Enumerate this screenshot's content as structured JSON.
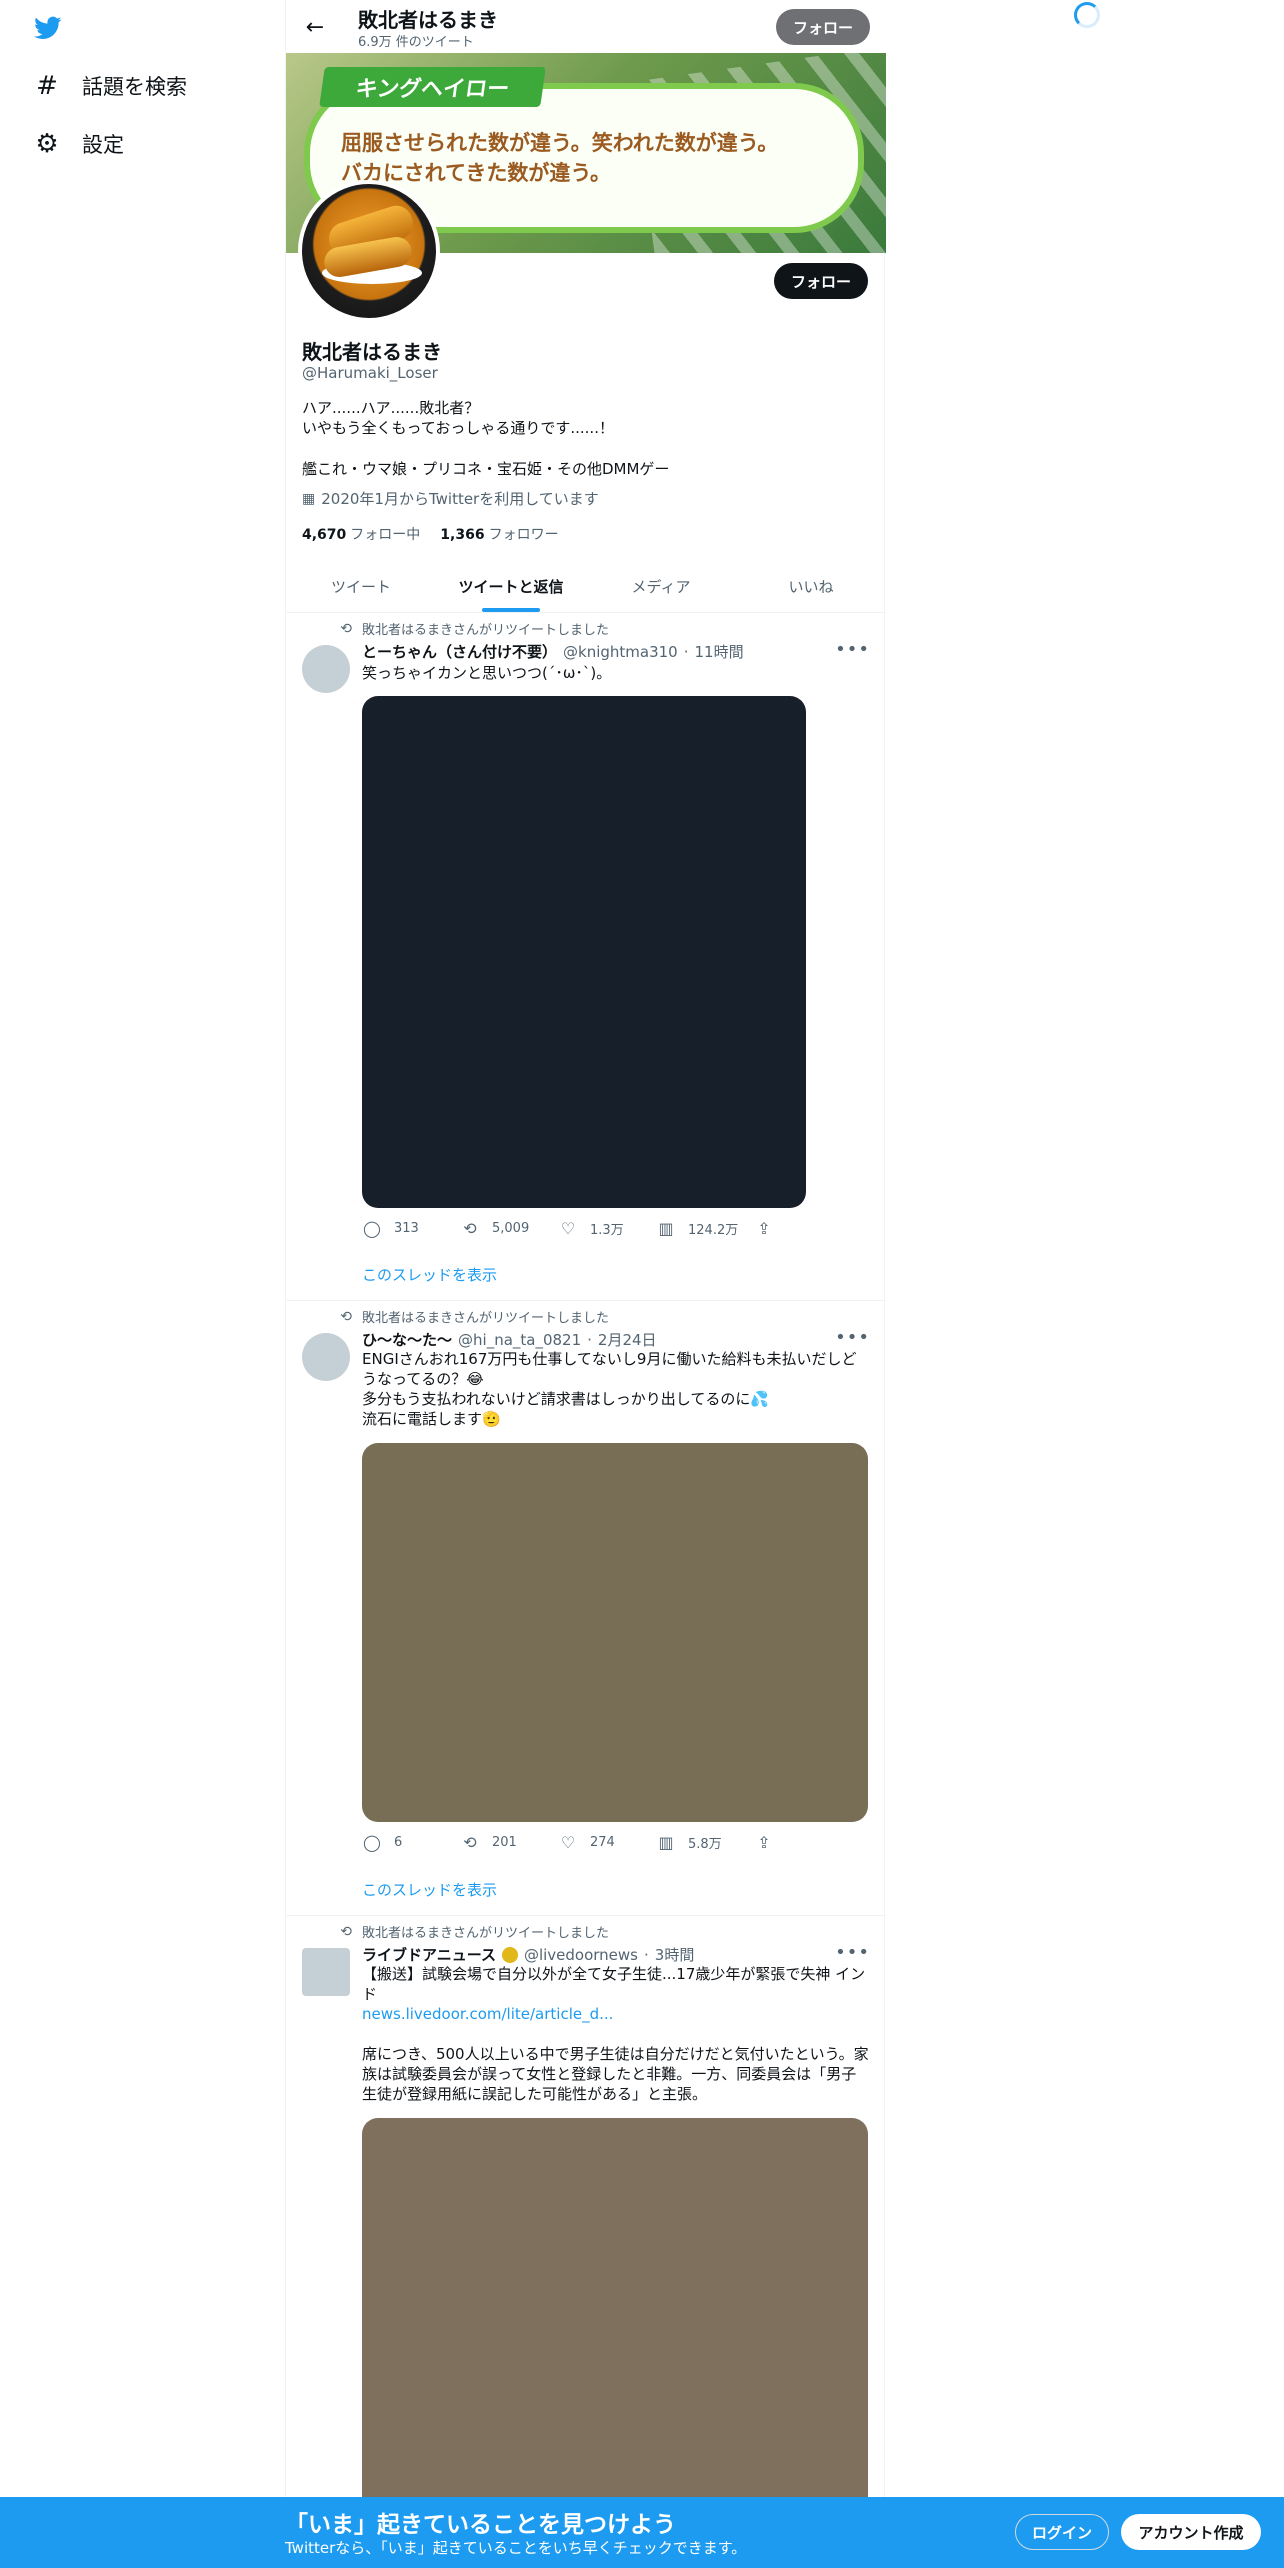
{
  "nav": {
    "explore_label": "話題を検索",
    "settings_label": "設定"
  },
  "header": {
    "name": "敗北者はるまき",
    "tweet_count": "6.9万 件のツイート",
    "follow_label": "フォロー"
  },
  "banner": {
    "tag": "キングヘイロー",
    "line1": "屈服させられた数が違う。笑われた数が違う。",
    "line2": "バカにされてきた数が違う。"
  },
  "profile": {
    "follow_label": "フォロー",
    "name": "敗北者はるまき",
    "handle": "@Harumaki_Loser",
    "bio_line1": "ハア......ハア......敗北者？",
    "bio_line2": "いやもう全くもっておっしゃる通りです......！",
    "bio_line3": "艦これ・ウマ娘・プリコネ・宝石姫・その他DMMゲー",
    "joined": "2020年1月からTwitterを利用しています",
    "following_count": "4,670",
    "following_label": "フォロー中",
    "followers_count": "1,366",
    "followers_label": "フォロワー"
  },
  "tabs": [
    {
      "label": "ツイート"
    },
    {
      "label": "ツイートと返信"
    },
    {
      "label": "メディア"
    },
    {
      "label": "いいね"
    }
  ],
  "tweets": [
    {
      "retweeted_by": "敗北者はるまきさんがリツイートしました",
      "name": "とーちゃん（さん付け不要）",
      "handle": "@knightma310",
      "time": "11時間",
      "text": "笑っちゃイカンと思いつつ(´･ω･`)。",
      "media_color": "#17202a",
      "replies": "313",
      "retweets": "5,009",
      "likes": "1.3万",
      "views": "124.2万",
      "show_thread": "このスレッドを表示"
    },
    {
      "retweeted_by": "敗北者はるまきさんがリツイートしました",
      "name": "ひ〜な〜た〜",
      "handle": "@hi_na_ta_0821",
      "time": "2月24日",
      "text_line1": "ENGIさんおれ167万円も仕事してないし9月に働いた給料も未払いだしどうなってるの？😂",
      "text_line2": "多分もう支払われないけど請求書はしっかり出してるのに💦",
      "text_line3": "流石に電話します🫡",
      "media_color": "#776e55",
      "replies": "6",
      "retweets": "201",
      "likes": "274",
      "views": "5.8万",
      "show_thread": "このスレッドを表示"
    },
    {
      "retweeted_by": "敗北者はるまきさんがリツイートしました",
      "name": "ライブドアニュース",
      "handle": "@livedoornews",
      "time": "3時間",
      "text_line1": "【搬送】試験会場で自分以外が全て女子生徒...17歳少年が緊張で失神 インド",
      "link": "news.livedoor.com/lite/article_d...",
      "text_line2": "席につき、500人以上いる中で男子生徒は自分だけだと気付いたという。家族は試験委員会が誤って女性と登録したと非難。一方、同委員会は「男子生徒が登録用紙に誤記した可能性がある」と主張。",
      "media_color": "#7f705e"
    }
  ],
  "bottom": {
    "title": "「いま」起きていることを見つけよう",
    "subtitle": "Twitterなら、「いま」起きていることをいち早くチェックできます。",
    "login_label": "ログイン",
    "signup_label": "アカウント作成"
  },
  "colors": {
    "accent": "#1d9bf0",
    "text": "#0f1419",
    "muted": "#536471"
  }
}
